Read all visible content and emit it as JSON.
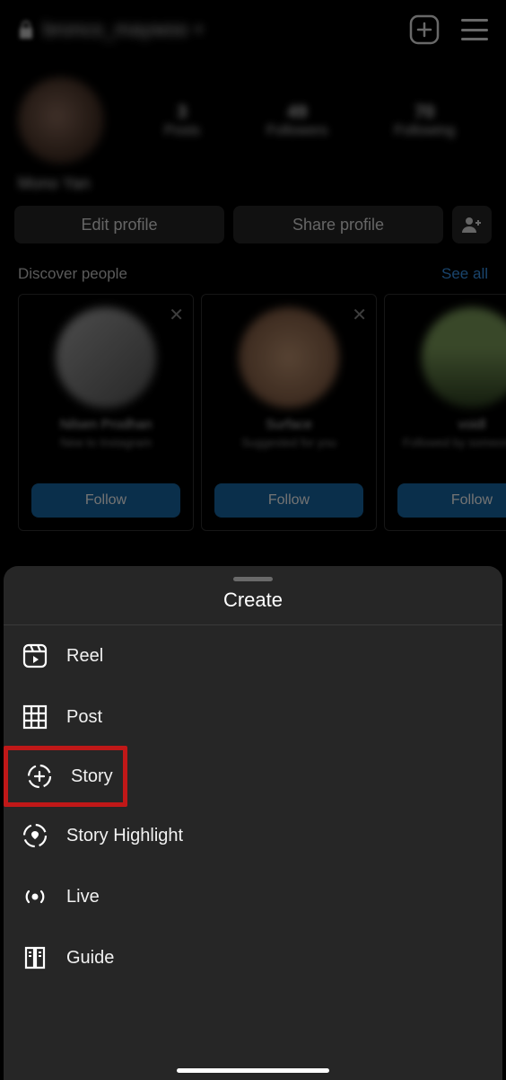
{
  "header": {
    "username": "bronco_maywoo",
    "add_label": "add",
    "menu_label": "menu"
  },
  "profile": {
    "name": "Mono Yan",
    "stats": [
      {
        "num": "3",
        "label": "Posts"
      },
      {
        "num": "49",
        "label": "Followers"
      },
      {
        "num": "70",
        "label": "Following"
      }
    ],
    "edit_label": "Edit profile",
    "share_label": "Share profile"
  },
  "discover": {
    "title": "Discover people",
    "see_all": "See all",
    "follow_label": "Follow",
    "cards": [
      {
        "name": "Nilsen Prodhan",
        "sub": "New to Instagram"
      },
      {
        "name": "Surface",
        "sub": "Suggested for you"
      },
      {
        "name": "voidl",
        "sub": "Followed by someone else"
      }
    ]
  },
  "sheet": {
    "title": "Create",
    "items": [
      {
        "key": "reel",
        "label": "Reel",
        "highlight": false
      },
      {
        "key": "post",
        "label": "Post",
        "highlight": false
      },
      {
        "key": "story",
        "label": "Story",
        "highlight": true
      },
      {
        "key": "story-highlight",
        "label": "Story Highlight",
        "highlight": false
      },
      {
        "key": "live",
        "label": "Live",
        "highlight": false
      },
      {
        "key": "guide",
        "label": "Guide",
        "highlight": false
      }
    ]
  }
}
